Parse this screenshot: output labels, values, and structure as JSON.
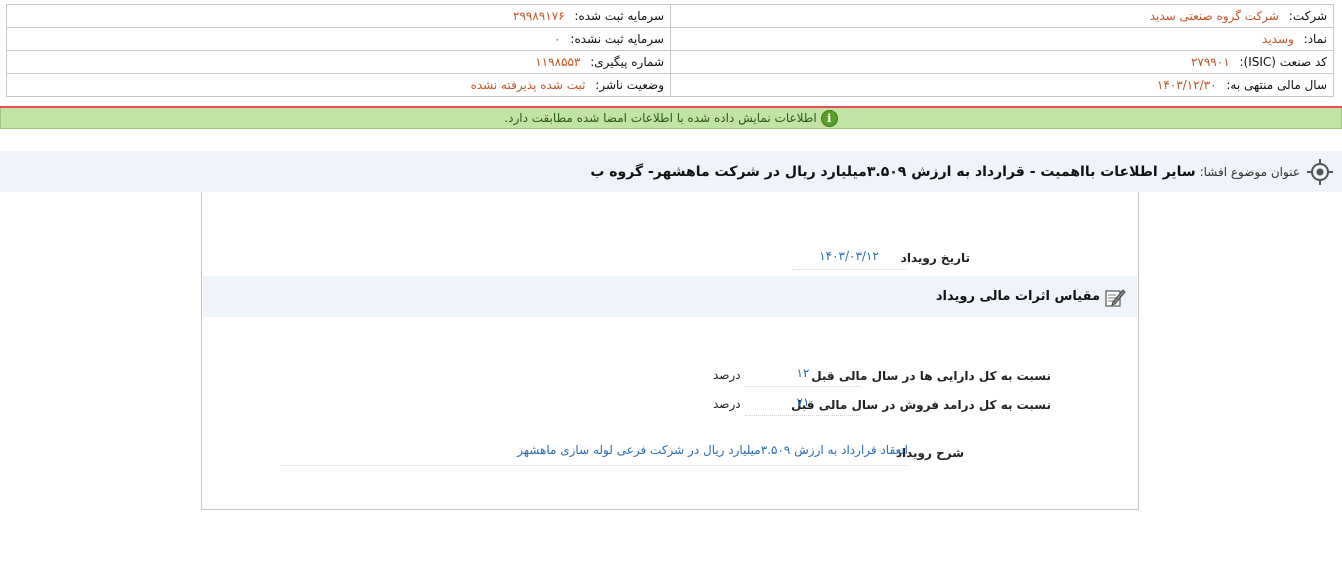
{
  "company_info": {
    "company_label": "شرکت:",
    "company_value": "شرکت گروه صنعتی سدید",
    "symbol_label": "نماد:",
    "symbol_value": "وسدید",
    "isic_label": "کد صنعت (ISIC):",
    "isic_value": "۲۷۹۹۰۱",
    "fiscal_year_label": "سال مالی منتهی به:",
    "fiscal_year_value": "۱۴۰۳/۱۲/۳۰",
    "registered_capital_label": "سرمایه ثبت شده:",
    "registered_capital_value": "۲۹۹۸۹۱۷۶",
    "unregistered_capital_label": "سرمایه ثبت نشده:",
    "unregistered_capital_value": "۰",
    "tracking_label": "شماره پیگیری:",
    "tracking_value": "۱۱۹۸۵۵۳",
    "publisher_status_label": "وضعیت ناشر:",
    "publisher_status_value": "ثبت شده پذیرفته نشده"
  },
  "notice": {
    "text": "اطلاعات نمایش داده شده با اطلاعات امضا شده مطابقت دارد.",
    "icon": "info-icon"
  },
  "subject": {
    "label": "عنوان موضوع افشا:",
    "title": "سایر اطلاعات بااهمیت - قرارداد به ارزش ۳.۵۰۹میلیارد ریال در شرکت ماهشهر- گروه ب",
    "icon": "target-icon"
  },
  "event": {
    "date_label": "تاریخ رویداد",
    "date_value": "۱۴۰۳/۰۳/۱۲"
  },
  "financial_section": {
    "title": "مقیاس اثرات مالی رویداد",
    "icon": "edit-icon",
    "rows": [
      {
        "label": "نسبت به کل دارایی ها در سال مالی قبل",
        "value": "۱۲",
        "unit": "درصد"
      },
      {
        "label": "نسبت به کل درامد فروش در سال مالی قبل",
        "value": "۷۱",
        "unit": "درصد"
      }
    ]
  },
  "description": {
    "label": "شرح رویداد",
    "value": "انعقاد قرارداد به ارزش ۳.۵۰۹میلیارد ریال در شرکت فرعی لوله سازی ماهشهر"
  },
  "colors": {
    "value_orange": "#c0562a",
    "value_blue": "#2a6db5",
    "notice_green": "#c2e2a6",
    "header_bg": "#eef4f9",
    "alert_red": "#e05050"
  }
}
